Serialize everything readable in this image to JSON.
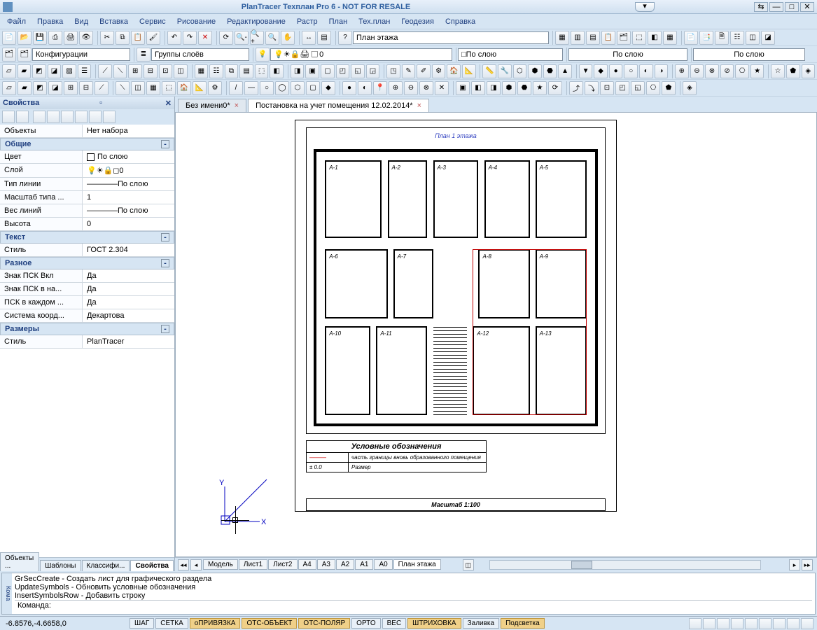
{
  "title": "PlanTracer Техплан Pro 6 - NOT FOR RESALE",
  "menu": [
    "Файл",
    "Правка",
    "Вид",
    "Вставка",
    "Сервис",
    "Рисование",
    "Редактирование",
    "Растр",
    "План",
    "Тех.план",
    "Геодезия",
    "Справка"
  ],
  "combo1": "План этажа",
  "configs_label": "Конфигурации",
  "layergroups_label": "Группы слоёв",
  "layer_value": "0",
  "bylayer": "По слою",
  "layer_checkbox": "□По слою",
  "props": {
    "panel_title": "Свойства",
    "objects_k": "Объекты",
    "objects_v": "Нет набора",
    "sections": {
      "general": "Общие",
      "text": "Текст",
      "misc": "Разное",
      "dims": "Размеры"
    },
    "rows": {
      "color_k": "Цвет",
      "color_v": "По слою",
      "layer_k": "Слой",
      "layer_v": "0",
      "ltype_k": "Тип линии",
      "ltype_v": "По слою",
      "ltscale_k": "Масштаб типа ...",
      "ltscale_v": "1",
      "lweight_k": "Вес линий",
      "lweight_v": "По слою",
      "height_k": "Высота",
      "height_v": "0",
      "tstyle_k": "Стиль",
      "tstyle_v": "ГОСТ 2.304",
      "ucsicon_k": "Знак ПСК Вкл",
      "ucsicon_v": "Да",
      "ucsiconpos_k": "Знак ПСК в на...",
      "ucsiconpos_v": "Да",
      "ucsperview_k": "ПСК в каждом ...",
      "ucsperview_v": "Да",
      "coordsys_k": "Система коорд...",
      "coordsys_v": "Декартова",
      "dstyle_k": "Стиль",
      "dstyle_v": "PlanTracer"
    },
    "bottom_tabs": [
      "Объекты ...",
      "Шаблоны",
      "Классифи...",
      "Свойства"
    ]
  },
  "doctabs": [
    {
      "label": "Без имени0*"
    },
    {
      "label": "Постановка на учет помещения 12.02.2014*"
    }
  ],
  "sheet": {
    "plan_title": "План 1 этажа",
    "legend_header": "Условные обозначения",
    "legend_row1": "часть границы вновь образованного помещения",
    "legend_row2_sym": "± 0.0",
    "legend_row2": "Размер",
    "scale": "Масштаб 1:100"
  },
  "model_tabs": [
    "Модель",
    "Лист1",
    "Лист2",
    "А4",
    "А3",
    "А2",
    "А1",
    "А0",
    "План этажа"
  ],
  "cmd": {
    "side": "Кома",
    "lines": [
      "GrSecCreate - Создать лист для графического раздела",
      "UpdateSymbols - Обновить условные обозначения",
      "InsertSymbolsRow - Добавить строку"
    ],
    "prompt": "Команда:"
  },
  "status": {
    "coord": "-6.8576,-4.6658,0",
    "buttons": [
      {
        "label": "ШАГ",
        "on": false
      },
      {
        "label": "СЕТКА",
        "on": false
      },
      {
        "label": "оПРИВЯЗКА",
        "on": true
      },
      {
        "label": "ОТС-ОБЪЕКТ",
        "on": true
      },
      {
        "label": "ОТС-ПОЛЯР",
        "on": true
      },
      {
        "label": "ОРТО",
        "on": false
      },
      {
        "label": "ВЕС",
        "on": false
      },
      {
        "label": "ШТРИХОВКА",
        "on": true
      },
      {
        "label": "Заливка",
        "on": false
      },
      {
        "label": "Подсветка",
        "on": true
      }
    ]
  },
  "ucs": {
    "x": "X",
    "y": "Y"
  }
}
